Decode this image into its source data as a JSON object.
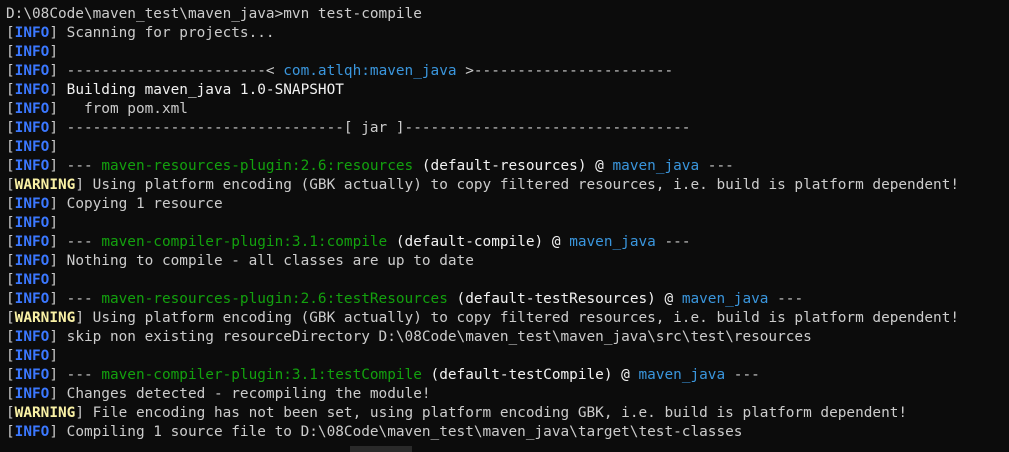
{
  "terminal": {
    "lines": [
      [
        {
          "t": "D:\\08Code\\maven_test\\maven_java>mvn test-compile",
          "c": "text"
        }
      ],
      [
        {
          "t": "[",
          "c": "text"
        },
        {
          "t": "INFO",
          "c": "blue"
        },
        {
          "t": "] Scanning for projects...",
          "c": "text"
        }
      ],
      [
        {
          "t": "[",
          "c": "text"
        },
        {
          "t": "INFO",
          "c": "blue"
        },
        {
          "t": "]",
          "c": "text"
        }
      ],
      [
        {
          "t": "[",
          "c": "text"
        },
        {
          "t": "INFO",
          "c": "blue"
        },
        {
          "t": "] -----------------------< ",
          "c": "text"
        },
        {
          "t": "com.atlqh:maven_java",
          "c": "cyan"
        },
        {
          "t": " >-----------------------",
          "c": "text"
        }
      ],
      [
        {
          "t": "[",
          "c": "text"
        },
        {
          "t": "INFO",
          "c": "blue"
        },
        {
          "t": "] ",
          "c": "text"
        },
        {
          "t": "Building maven_java 1.0-SNAPSHOT",
          "c": "white"
        }
      ],
      [
        {
          "t": "[",
          "c": "text"
        },
        {
          "t": "INFO",
          "c": "blue"
        },
        {
          "t": "]   from pom.xml",
          "c": "text"
        }
      ],
      [
        {
          "t": "[",
          "c": "text"
        },
        {
          "t": "INFO",
          "c": "blue"
        },
        {
          "t": "] --------------------------------[ jar ]---------------------------------",
          "c": "text"
        }
      ],
      [
        {
          "t": "[",
          "c": "text"
        },
        {
          "t": "INFO",
          "c": "blue"
        },
        {
          "t": "]",
          "c": "text"
        }
      ],
      [
        {
          "t": "[",
          "c": "text"
        },
        {
          "t": "INFO",
          "c": "blue"
        },
        {
          "t": "] --- ",
          "c": "text"
        },
        {
          "t": "maven-resources-plugin:2.6:resources",
          "c": "green"
        },
        {
          "t": " (default-resources) @ ",
          "c": "white"
        },
        {
          "t": "maven_java",
          "c": "cyan"
        },
        {
          "t": " ---",
          "c": "text"
        }
      ],
      [
        {
          "t": "[",
          "c": "text"
        },
        {
          "t": "WARNING",
          "c": "yellow"
        },
        {
          "t": "] Using platform encoding (GBK actually) to copy filtered resources, i.e. build is platform dependent!",
          "c": "text"
        }
      ],
      [
        {
          "t": "[",
          "c": "text"
        },
        {
          "t": "INFO",
          "c": "blue"
        },
        {
          "t": "] Copying 1 resource",
          "c": "text"
        }
      ],
      [
        {
          "t": "[",
          "c": "text"
        },
        {
          "t": "INFO",
          "c": "blue"
        },
        {
          "t": "]",
          "c": "text"
        }
      ],
      [
        {
          "t": "[",
          "c": "text"
        },
        {
          "t": "INFO",
          "c": "blue"
        },
        {
          "t": "] --- ",
          "c": "text"
        },
        {
          "t": "maven-compiler-plugin:3.1:compile",
          "c": "green"
        },
        {
          "t": " (default-compile) @ ",
          "c": "white"
        },
        {
          "t": "maven_java",
          "c": "cyan"
        },
        {
          "t": " ---",
          "c": "text"
        }
      ],
      [
        {
          "t": "[",
          "c": "text"
        },
        {
          "t": "INFO",
          "c": "blue"
        },
        {
          "t": "] Nothing to compile - all classes are up to date",
          "c": "text"
        }
      ],
      [
        {
          "t": "[",
          "c": "text"
        },
        {
          "t": "INFO",
          "c": "blue"
        },
        {
          "t": "]",
          "c": "text"
        }
      ],
      [
        {
          "t": "[",
          "c": "text"
        },
        {
          "t": "INFO",
          "c": "blue"
        },
        {
          "t": "] --- ",
          "c": "text"
        },
        {
          "t": "maven-resources-plugin:2.6:testResources",
          "c": "green"
        },
        {
          "t": " (default-testResources) @ ",
          "c": "white"
        },
        {
          "t": "maven_java",
          "c": "cyan"
        },
        {
          "t": " ---",
          "c": "text"
        }
      ],
      [
        {
          "t": "[",
          "c": "text"
        },
        {
          "t": "WARNING",
          "c": "yellow"
        },
        {
          "t": "] Using platform encoding (GBK actually) to copy filtered resources, i.e. build is platform dependent!",
          "c": "text"
        }
      ],
      [
        {
          "t": "[",
          "c": "text"
        },
        {
          "t": "INFO",
          "c": "blue"
        },
        {
          "t": "] skip non existing resourceDirectory D:\\08Code\\maven_test\\maven_java\\src\\test\\resources",
          "c": "text"
        }
      ],
      [
        {
          "t": "[",
          "c": "text"
        },
        {
          "t": "INFO",
          "c": "blue"
        },
        {
          "t": "]",
          "c": "text"
        }
      ],
      [
        {
          "t": "[",
          "c": "text"
        },
        {
          "t": "INFO",
          "c": "blue"
        },
        {
          "t": "] --- ",
          "c": "text"
        },
        {
          "t": "maven-compiler-plugin:3.1:testCompile",
          "c": "green"
        },
        {
          "t": " (default-testCompile) @ ",
          "c": "white"
        },
        {
          "t": "maven_java",
          "c": "cyan"
        },
        {
          "t": " ---",
          "c": "text"
        }
      ],
      [
        {
          "t": "[",
          "c": "text"
        },
        {
          "t": "INFO",
          "c": "blue"
        },
        {
          "t": "] Changes detected - recompiling the module!",
          "c": "text"
        }
      ],
      [
        {
          "t": "[",
          "c": "text"
        },
        {
          "t": "WARNING",
          "c": "yellow"
        },
        {
          "t": "] File encoding has not been set, using platform encoding GBK, i.e. build is platform dependent!",
          "c": "text"
        }
      ],
      [
        {
          "t": "[",
          "c": "text"
        },
        {
          "t": "INFO",
          "c": "blue"
        },
        {
          "t": "] Compiling 1 source file to D:\\08Code\\maven_test\\maven_java\\target\\test-classes",
          "c": "text"
        }
      ]
    ]
  },
  "colors": {
    "background": "#0c0c0c",
    "text": "#cccccc",
    "white": "#f2f2f2",
    "info_blue": "#3b78ff",
    "plugin_green": "#13a10e",
    "warning_yellow": "#f9f1a5",
    "artifact_cyan": "#3a96dd"
  }
}
